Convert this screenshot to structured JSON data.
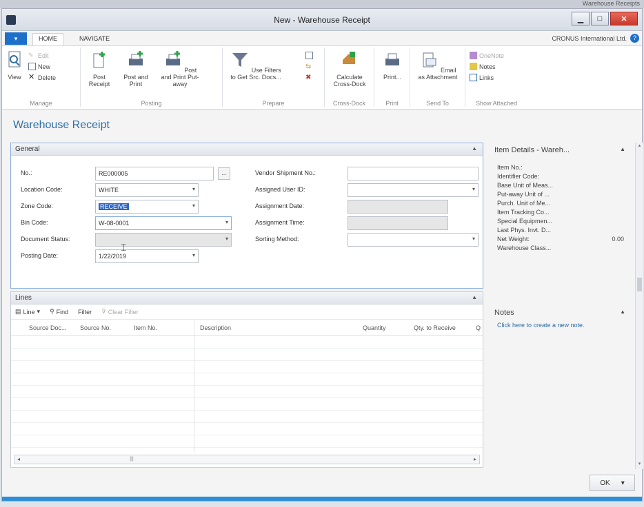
{
  "topstrip": {
    "text": "Warehouse Receipts"
  },
  "window": {
    "title": "New - Warehouse Receipt"
  },
  "tabs": {
    "file": "▾",
    "home": "HOME",
    "navigate": "NAVIGATE",
    "company": "CRONUS International Ltd."
  },
  "ribbon": {
    "manage": {
      "label": "Manage",
      "view": "View",
      "edit": "Edit",
      "new": "New",
      "delete": "Delete"
    },
    "posting": {
      "label": "Posting",
      "post_receipt": "Post Receipt",
      "post_and_print": "Post and Print",
      "post_and_print_putaway": "Post and Print Put-away"
    },
    "prepare": {
      "label": "Prepare",
      "use_filters": "Use Filters to Get Src. Docs..."
    },
    "cross_dock": {
      "label": "Cross-Dock",
      "calculate": "Calculate Cross-Dock"
    },
    "print": {
      "label": "Print",
      "print": "Print..."
    },
    "send_to": {
      "label": "Send To",
      "email": "Email as Attachment"
    },
    "show_attached": {
      "label": "Show Attached",
      "onenote": "OneNote",
      "notes": "Notes",
      "links": "Links"
    }
  },
  "page": {
    "title": "Warehouse Receipt"
  },
  "general": {
    "header": "General",
    "no_label": "No.:",
    "no_value": "RE000005",
    "location_label": "Location Code:",
    "location_value": "WHITE",
    "zone_label": "Zone Code:",
    "zone_value": "RECEIVE",
    "bin_label": "Bin Code:",
    "bin_value": "W-08-0001",
    "status_label": "Document Status:",
    "status_value": "",
    "posting_label": "Posting Date:",
    "posting_value": "1/22/2019",
    "vendor_ship_label": "Vendor Shipment No.:",
    "assigned_user_label": "Assigned User ID:",
    "assign_date_label": "Assignment Date:",
    "assign_time_label": "Assignment Time:",
    "sorting_label": "Sorting Method:"
  },
  "lines": {
    "header": "Lines",
    "tool_line": "Line",
    "tool_find": "Find",
    "tool_filter": "Filter",
    "tool_clear": "Clear Filter",
    "columns": [
      "Source Doc...",
      "Source No.",
      "Item No.",
      "Description",
      "Quantity",
      "Qty. to Receive",
      "Q"
    ]
  },
  "factbox_item": {
    "header": "Item Details - Wareh...",
    "items": [
      "Item No.:",
      "Identifier Code:",
      "Base Unit of Meas...",
      "Put-away Unit of ...",
      "Purch. Unit of Me...",
      "Item Tracking Co...",
      "Special Equipmen...",
      "Last Phys. Invt. D..."
    ],
    "net_weight_label": "Net Weight:",
    "net_weight_value": "0.00",
    "warehouse_class": "Warehouse Class..."
  },
  "factbox_notes": {
    "header": "Notes",
    "link": "Click here to create a new note."
  },
  "footer": {
    "ok": "OK"
  },
  "colors": {
    "accent": "#2d6ea8",
    "file_tab": "#1e6fc9",
    "selection": "#2f66c8"
  }
}
